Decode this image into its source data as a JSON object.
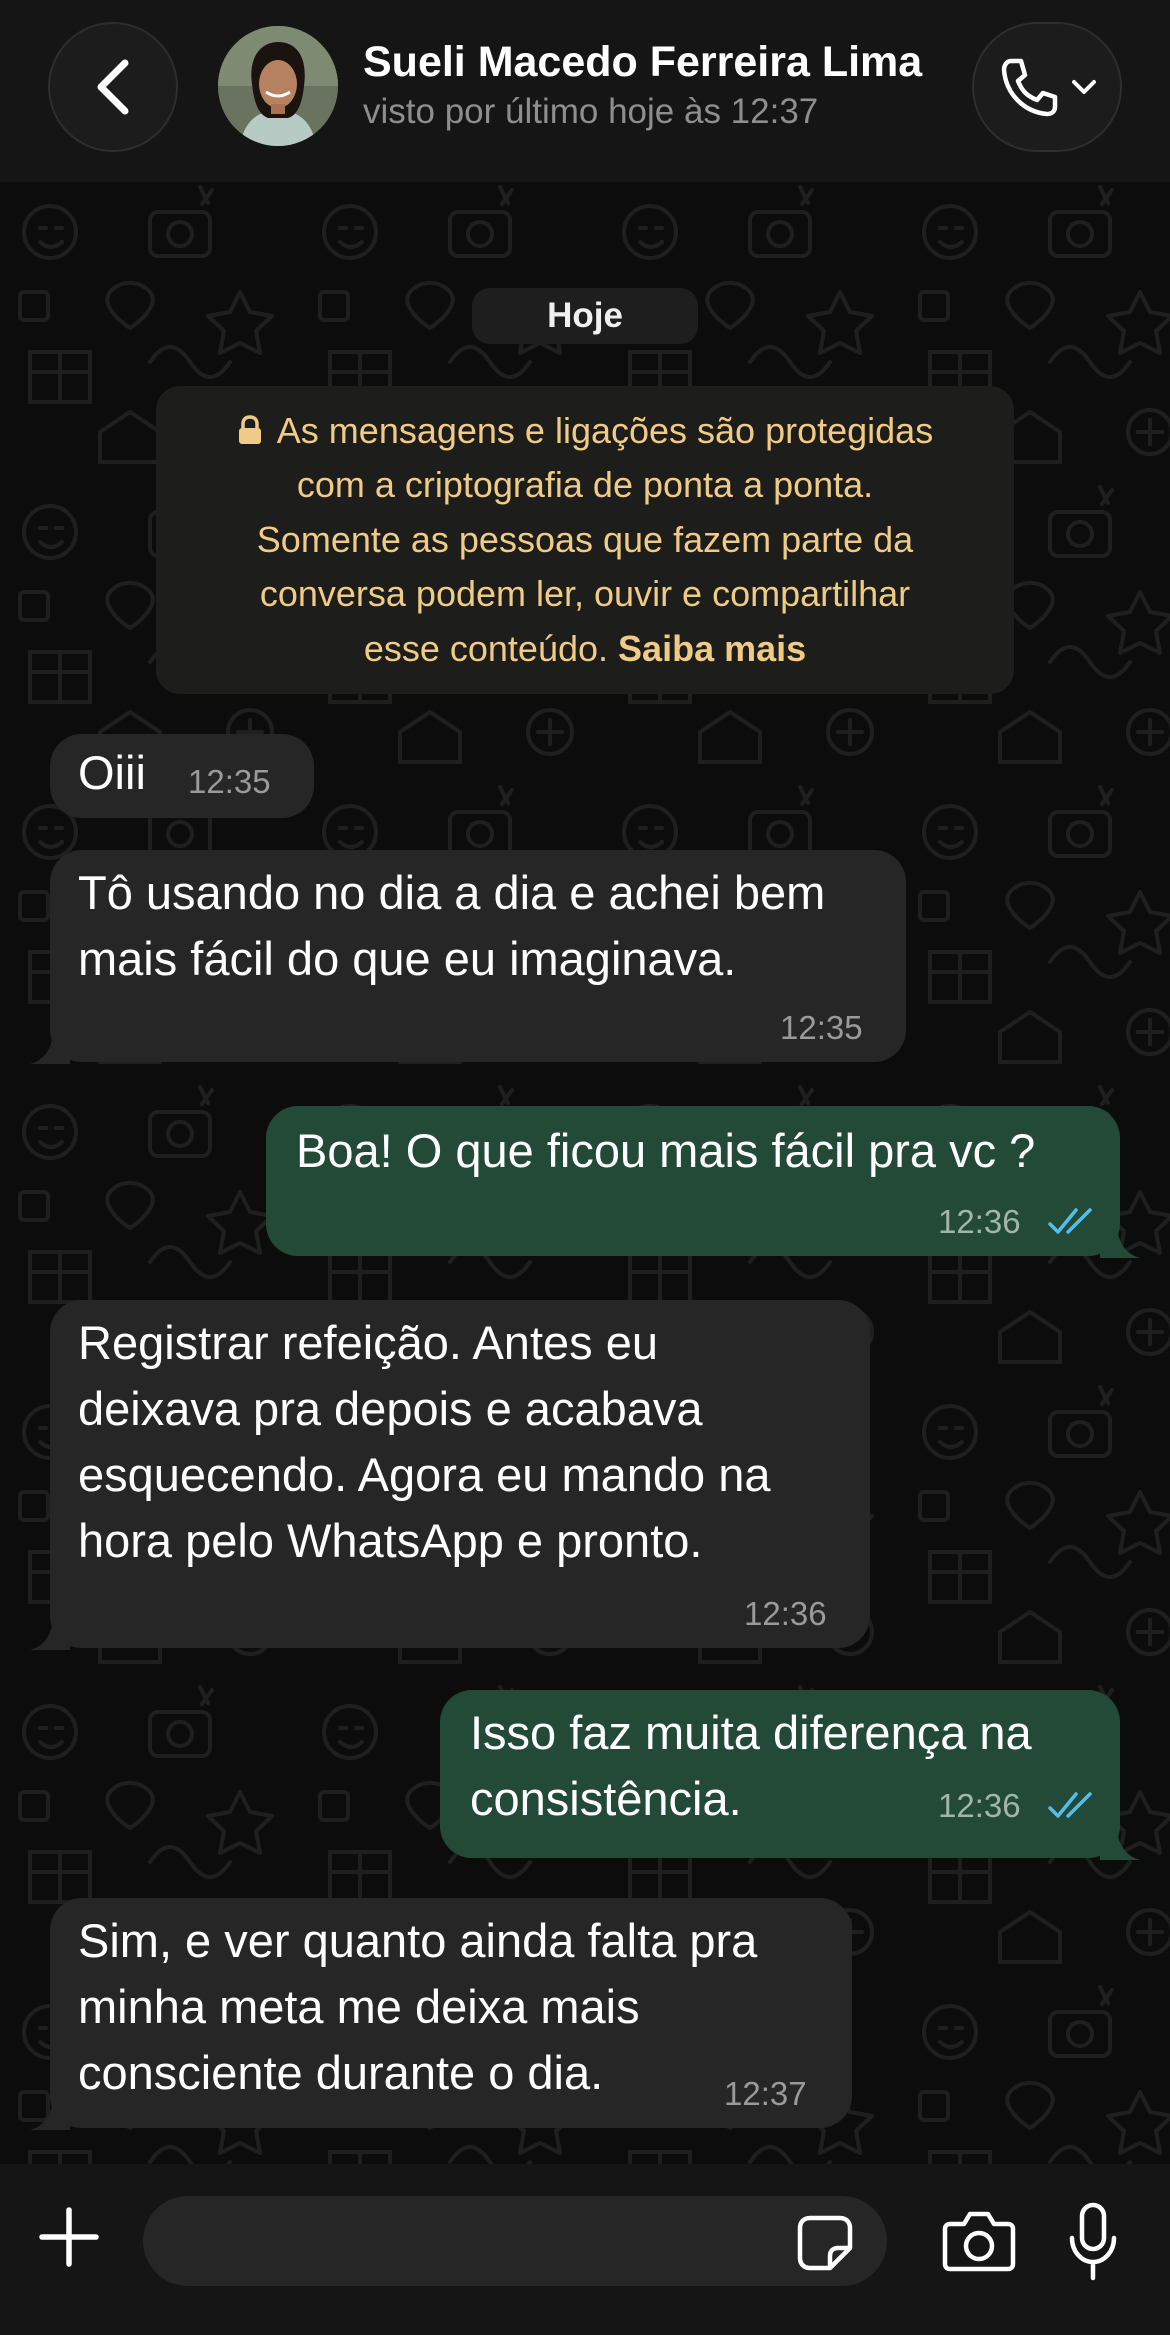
{
  "header": {
    "contact_name": "Sueli Macedo Ferreira Lima",
    "status": "visto por último hoje às 12:37",
    "back_icon": "chevron-left-icon",
    "call_icon": "phone-icon",
    "call_menu_icon": "chevron-down-icon"
  },
  "chat": {
    "date_label": "Hoje",
    "encryption_notice": {
      "lines": [
        "As mensagens e ligações são protegidas",
        "com a criptografia de ponta a ponta.",
        "Somente as pessoas que fazem parte da",
        "conversa podem ler, ouvir e compartilhar",
        "esse conteúdo."
      ],
      "link": "Saiba mais"
    },
    "messages": [
      {
        "direction": "incoming",
        "lines": [
          "Oiii"
        ],
        "time": "12:35"
      },
      {
        "direction": "incoming",
        "lines": [
          "Tô usando no dia a dia e achei bem",
          "mais fácil do que eu imaginava."
        ],
        "time": "12:35"
      },
      {
        "direction": "outgoing",
        "lines": [
          "Boa! O que ficou mais fácil pra vc ?"
        ],
        "time": "12:36",
        "status": "read"
      },
      {
        "direction": "incoming",
        "lines": [
          "Registrar refeição. Antes eu",
          "deixava pra depois e acabava",
          "esquecendo. Agora eu mando na",
          "hora pelo WhatsApp e pronto."
        ],
        "time": "12:36"
      },
      {
        "direction": "outgoing",
        "lines": [
          "Isso faz muita diferença na",
          "consistência."
        ],
        "time": "12:36",
        "status": "read"
      },
      {
        "direction": "incoming",
        "lines": [
          "Sim, e ver quanto ainda falta pra",
          "minha meta me deixa mais",
          "consciente durante o dia."
        ],
        "time": "12:37"
      }
    ]
  },
  "input_bar": {
    "placeholder": "",
    "icons": [
      "plus-icon",
      "sticker-icon",
      "camera-icon",
      "microphone-icon"
    ]
  },
  "colors": {
    "header_bg": "#151515",
    "incoming_bubble": "#262626",
    "outgoing_bubble": "#234a37",
    "notice_text": "#f0cb85",
    "read_ticks": "#53bdeb"
  }
}
